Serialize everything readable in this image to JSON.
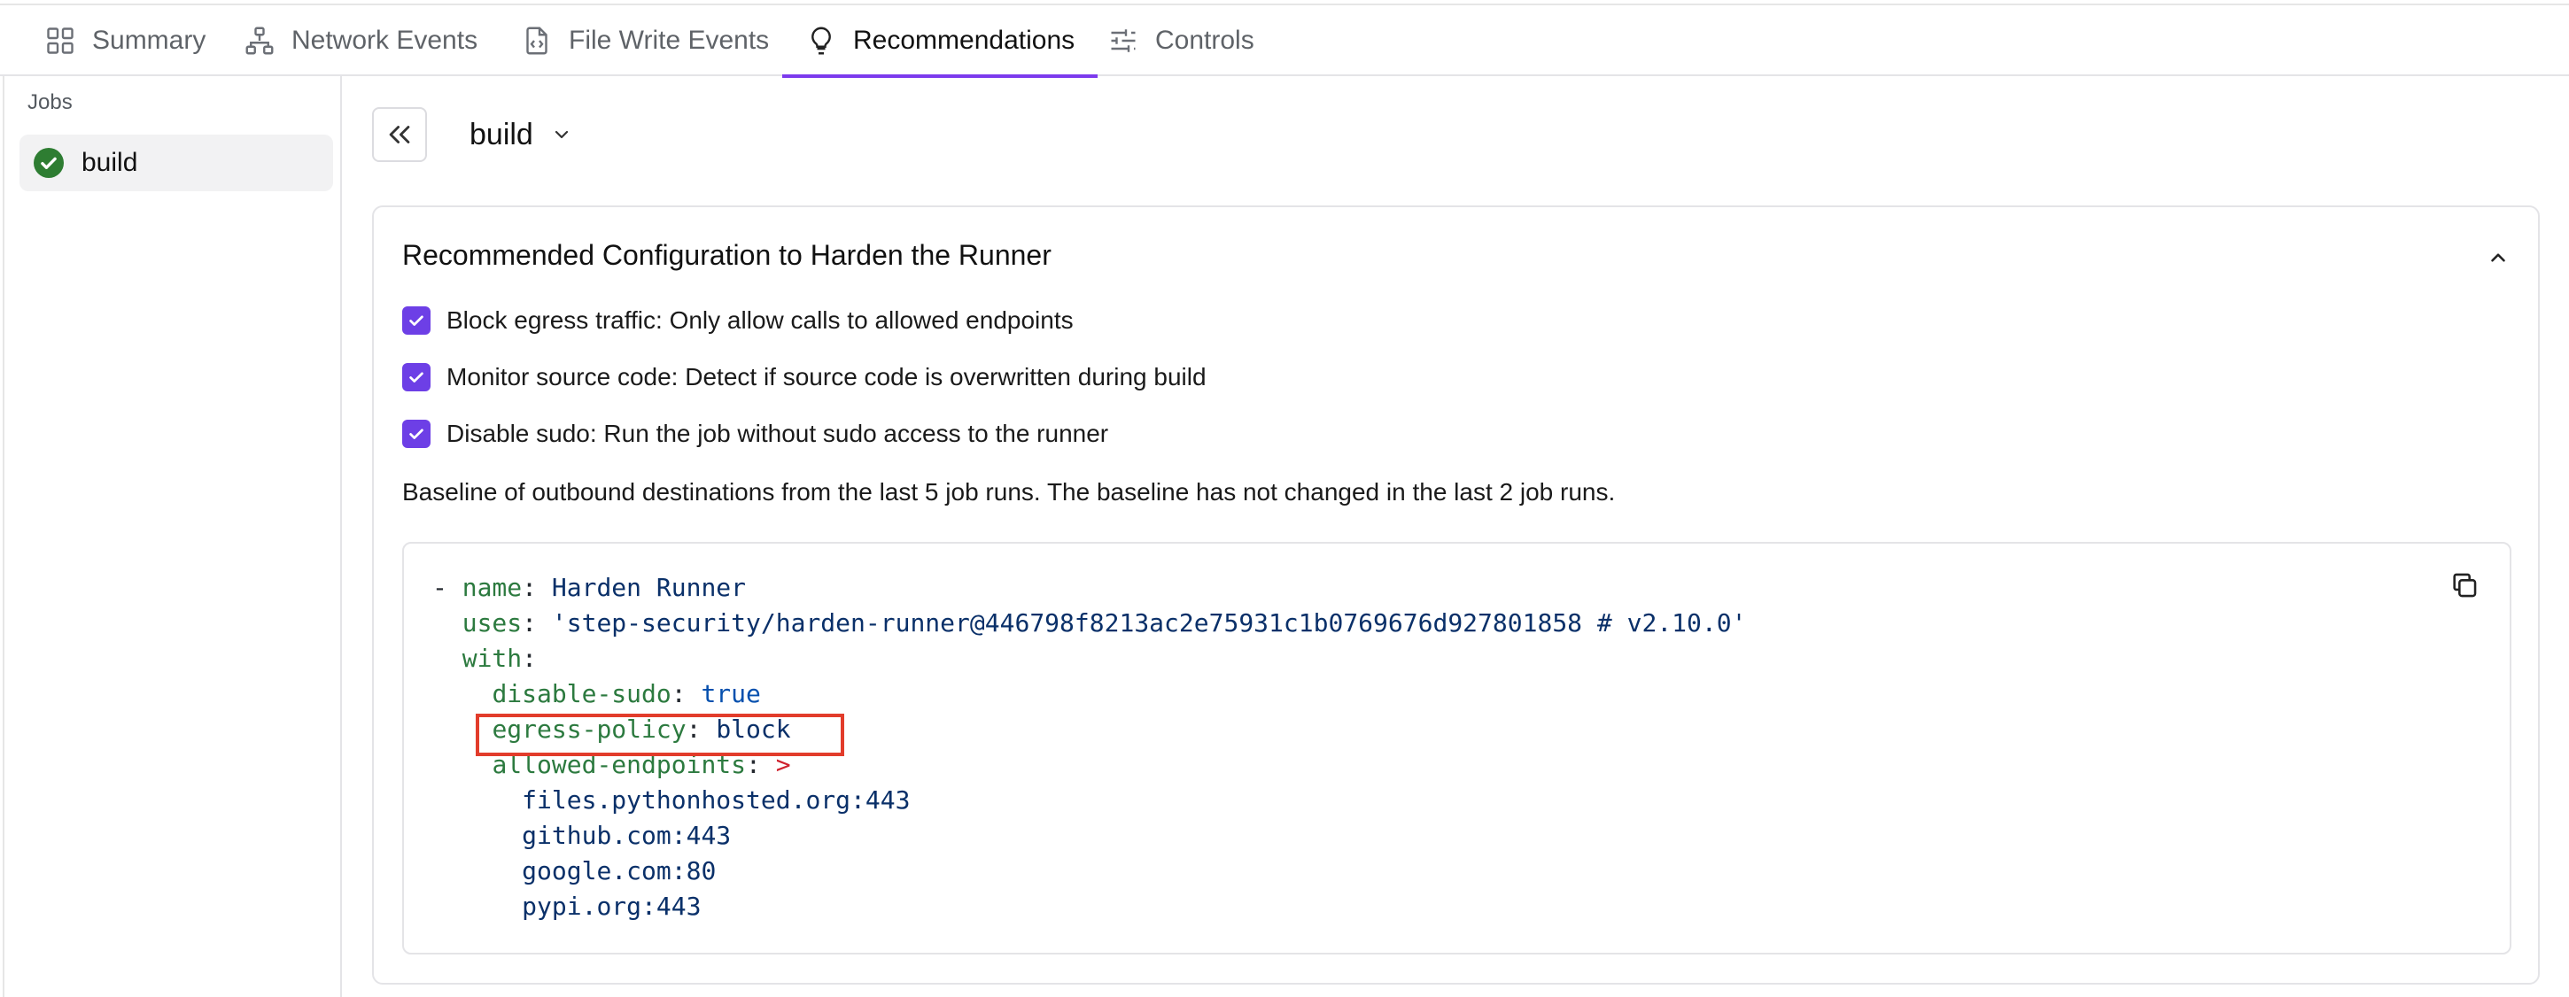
{
  "tabs": [
    {
      "label": "Summary",
      "icon": "grid-icon",
      "active": false
    },
    {
      "label": "Network Events",
      "icon": "network-icon",
      "active": false
    },
    {
      "label": "File Write Events",
      "icon": "file-code-icon",
      "active": false
    },
    {
      "label": "Recommendations",
      "icon": "lightbulb-icon",
      "active": true
    },
    {
      "label": "Controls",
      "icon": "sliders-icon",
      "active": false
    }
  ],
  "sidebar": {
    "heading": "Jobs",
    "jobs": [
      {
        "label": "build",
        "status": "success"
      }
    ]
  },
  "main": {
    "job_selector": "build",
    "card": {
      "title": "Recommended Configuration to Harden the Runner",
      "options": [
        {
          "label": "Block egress traffic: Only allow calls to allowed endpoints",
          "checked": true
        },
        {
          "label": "Monitor source code: Detect if source code is overwritten during build",
          "checked": true
        },
        {
          "label": "Disable sudo: Run the job without sudo access to the runner",
          "checked": true
        }
      ],
      "baseline_text": "Baseline of outbound destinations from the last 5 job runs. The baseline has not changed in the last 2 job runs.",
      "code": {
        "name_key": "name",
        "name_value": "Harden Runner",
        "uses_key": "uses",
        "uses_value": "'step-security/harden-runner@446798f8213ac2e75931c1b0769676d927801858 # v2.10.0'",
        "with_key": "with",
        "disable_sudo_key": "disable-sudo",
        "disable_sudo_value": "true",
        "egress_key": "egress-policy",
        "egress_value": "block",
        "allowed_key": "allowed-endpoints",
        "allowed_marker": ">",
        "endpoints": [
          "files.pythonhosted.org:443",
          "github.com:443",
          "google.com:80",
          "pypi.org:443"
        ]
      }
    }
  },
  "colors": {
    "accent": "#7c3aed",
    "checkbox": "#6d3fe6",
    "success": "#2e7d32",
    "highlight": "#e23c2b"
  }
}
